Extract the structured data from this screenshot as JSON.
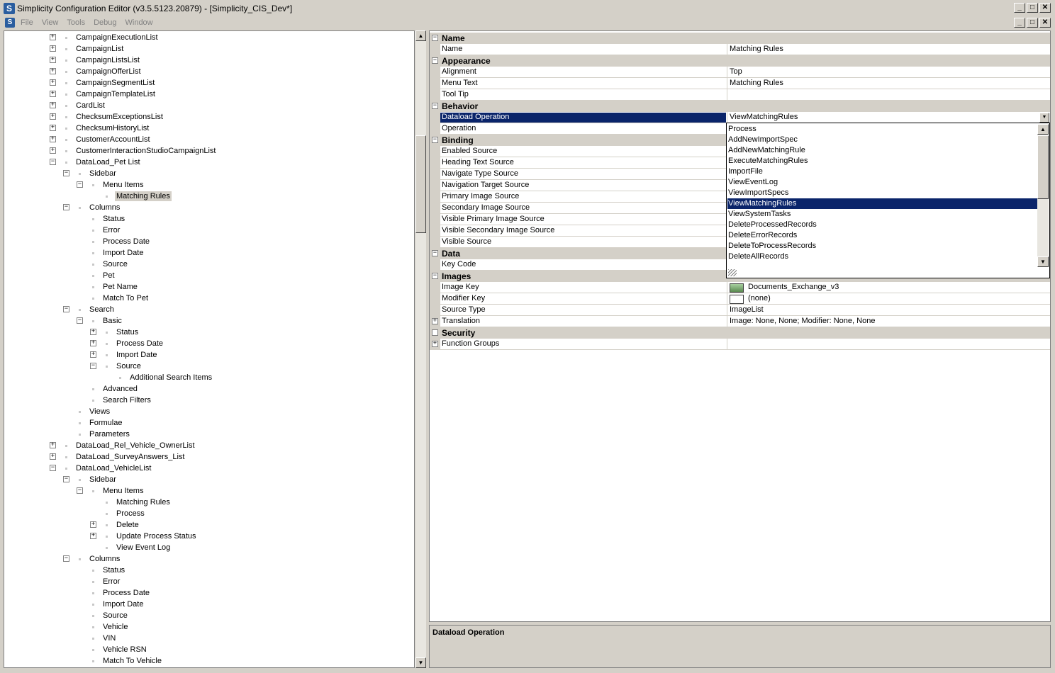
{
  "window": {
    "title": "Simplicity Configuration Editor (v3.5.5123.20879) - [Simplicity_CIS_Dev*]",
    "minimize": "_",
    "maximize": "□",
    "close": "✕"
  },
  "menubar": {
    "items": [
      "File",
      "View",
      "Tools",
      "Debug",
      "Window"
    ]
  },
  "tree": {
    "rows": [
      {
        "label": "CampaignExecutionList",
        "level": 0,
        "toggle": "+"
      },
      {
        "label": "CampaignList",
        "level": 0,
        "toggle": "+"
      },
      {
        "label": "CampaignListsList",
        "level": 0,
        "toggle": "+"
      },
      {
        "label": "CampaignOfferList",
        "level": 0,
        "toggle": "+"
      },
      {
        "label": "CampaignSegmentList",
        "level": 0,
        "toggle": "+"
      },
      {
        "label": "CampaignTemplateList",
        "level": 0,
        "toggle": "+"
      },
      {
        "label": "CardList",
        "level": 0,
        "toggle": "+"
      },
      {
        "label": "ChecksumExceptionsList",
        "level": 0,
        "toggle": "+"
      },
      {
        "label": "ChecksumHistoryList",
        "level": 0,
        "toggle": "+"
      },
      {
        "label": "CustomerAccountList",
        "level": 0,
        "toggle": "+"
      },
      {
        "label": "CustomerInteractionStudioCampaignList",
        "level": 0,
        "toggle": "+"
      },
      {
        "label": "DataLoad_Pet List",
        "level": 0,
        "toggle": "−"
      },
      {
        "label": "Sidebar",
        "level": 1,
        "toggle": "−"
      },
      {
        "label": "Menu Items",
        "level": 2,
        "toggle": "−"
      },
      {
        "label": "Matching Rules",
        "level": 3,
        "toggle": "",
        "selected": true
      },
      {
        "label": "Columns",
        "level": 1,
        "toggle": "−"
      },
      {
        "label": "Status",
        "level": 2,
        "toggle": ""
      },
      {
        "label": "Error",
        "level": 2,
        "toggle": ""
      },
      {
        "label": "Process Date",
        "level": 2,
        "toggle": ""
      },
      {
        "label": "Import Date",
        "level": 2,
        "toggle": ""
      },
      {
        "label": "Source",
        "level": 2,
        "toggle": ""
      },
      {
        "label": "Pet",
        "level": 2,
        "toggle": ""
      },
      {
        "label": "Pet Name",
        "level": 2,
        "toggle": ""
      },
      {
        "label": "Match To Pet",
        "level": 2,
        "toggle": ""
      },
      {
        "label": "Search",
        "level": 1,
        "toggle": "−"
      },
      {
        "label": "Basic",
        "level": 2,
        "toggle": "−"
      },
      {
        "label": "Status",
        "level": 3,
        "toggle": "+"
      },
      {
        "label": "Process Date",
        "level": 3,
        "toggle": "+"
      },
      {
        "label": "Import Date",
        "level": 3,
        "toggle": "+"
      },
      {
        "label": "Source",
        "level": 3,
        "toggle": "−"
      },
      {
        "label": "Additional Search Items",
        "level": 4,
        "toggle": ""
      },
      {
        "label": "Advanced",
        "level": 2,
        "toggle": ""
      },
      {
        "label": "Search Filters",
        "level": 2,
        "toggle": ""
      },
      {
        "label": "Views",
        "level": 1,
        "toggle": ""
      },
      {
        "label": "Formulae",
        "level": 1,
        "toggle": ""
      },
      {
        "label": "Parameters",
        "level": 1,
        "toggle": ""
      },
      {
        "label": "DataLoad_Rel_Vehicle_OwnerList",
        "level": 0,
        "toggle": "+"
      },
      {
        "label": "DataLoad_SurveyAnswers_List",
        "level": 0,
        "toggle": "+"
      },
      {
        "label": "DataLoad_VehicleList",
        "level": 0,
        "toggle": "−"
      },
      {
        "label": "Sidebar",
        "level": 1,
        "toggle": "−"
      },
      {
        "label": "Menu Items",
        "level": 2,
        "toggle": "−"
      },
      {
        "label": "Matching Rules",
        "level": 3,
        "toggle": ""
      },
      {
        "label": "Process",
        "level": 3,
        "toggle": ""
      },
      {
        "label": "Delete",
        "level": 3,
        "toggle": "+"
      },
      {
        "label": "Update Process Status",
        "level": 3,
        "toggle": "+"
      },
      {
        "label": "View Event Log",
        "level": 3,
        "toggle": ""
      },
      {
        "label": "Columns",
        "level": 1,
        "toggle": "−"
      },
      {
        "label": "Status",
        "level": 2,
        "toggle": ""
      },
      {
        "label": "Error",
        "level": 2,
        "toggle": ""
      },
      {
        "label": "Process Date",
        "level": 2,
        "toggle": ""
      },
      {
        "label": "Import Date",
        "level": 2,
        "toggle": ""
      },
      {
        "label": "Source",
        "level": 2,
        "toggle": ""
      },
      {
        "label": "Vehicle",
        "level": 2,
        "toggle": ""
      },
      {
        "label": "VIN",
        "level": 2,
        "toggle": ""
      },
      {
        "label": "Vehicle RSN",
        "level": 2,
        "toggle": ""
      },
      {
        "label": "Match To Vehicle",
        "level": 2,
        "toggle": ""
      }
    ]
  },
  "properties": {
    "rows": [
      {
        "type": "cat",
        "name": "Name",
        "toggle": "−"
      },
      {
        "type": "prop",
        "name": "Name",
        "value": "Matching Rules"
      },
      {
        "type": "cat",
        "name": "Appearance",
        "toggle": "−"
      },
      {
        "type": "prop",
        "name": "Alignment",
        "value": "Top"
      },
      {
        "type": "prop",
        "name": "Menu Text",
        "value": "Matching Rules"
      },
      {
        "type": "prop",
        "name": "Tool Tip",
        "value": ""
      },
      {
        "type": "cat",
        "name": "Behavior",
        "toggle": "−"
      },
      {
        "type": "prop",
        "name": "Dataload Operation",
        "value": "ViewMatchingRules",
        "selected": true,
        "dropdown": true
      },
      {
        "type": "prop",
        "name": "Operation",
        "value": ""
      },
      {
        "type": "cat",
        "name": "Binding",
        "toggle": "−"
      },
      {
        "type": "prop",
        "name": "Enabled Source",
        "value": ""
      },
      {
        "type": "prop",
        "name": "Heading Text Source",
        "value": ""
      },
      {
        "type": "prop",
        "name": "Navigate Type Source",
        "value": ""
      },
      {
        "type": "prop",
        "name": "Navigation Target Source",
        "value": ""
      },
      {
        "type": "prop",
        "name": "Primary Image Source",
        "value": ""
      },
      {
        "type": "prop",
        "name": "Secondary Image Source",
        "value": ""
      },
      {
        "type": "prop",
        "name": "Visible Primary Image Source",
        "value": ""
      },
      {
        "type": "prop",
        "name": "Visible Secondary Image Source",
        "value": ""
      },
      {
        "type": "prop",
        "name": "Visible Source",
        "value": ""
      },
      {
        "type": "cat",
        "name": "Data",
        "toggle": "−"
      },
      {
        "type": "prop",
        "name": "Key Code",
        "value": ""
      },
      {
        "type": "cat",
        "name": "Images",
        "toggle": "−"
      },
      {
        "type": "prop",
        "name": "Image Key",
        "value": "Documents_Exchange_v3",
        "icon": "image"
      },
      {
        "type": "prop",
        "name": "Modifier Key",
        "value": "(none)",
        "icon": "empty"
      },
      {
        "type": "prop",
        "name": "Source Type",
        "value": "ImageList"
      },
      {
        "type": "prop",
        "name": "Translation",
        "value": "Image: None, None; Modifier: None, None",
        "expand": "+"
      },
      {
        "type": "cat",
        "name": "Security",
        "toggle": ""
      },
      {
        "type": "prop",
        "name": "Function Groups",
        "value": "",
        "expand": "+"
      }
    ]
  },
  "dropdown": {
    "options": [
      "Process",
      "AddNewImportSpec",
      "AddNewMatchingRule",
      "ExecuteMatchingRules",
      "ImportFile",
      "ViewEventLog",
      "ViewImportSpecs",
      "ViewMatchingRules",
      "ViewSystemTasks",
      "DeleteProcessedRecords",
      "DeleteErrorRecords",
      "DeleteToProcessRecords",
      "DeleteAllRecords"
    ],
    "selected_index": 7
  },
  "help": {
    "title": "Dataload Operation"
  },
  "colors": {
    "selection": "#0a246a",
    "chrome": "#d4d0c8"
  }
}
